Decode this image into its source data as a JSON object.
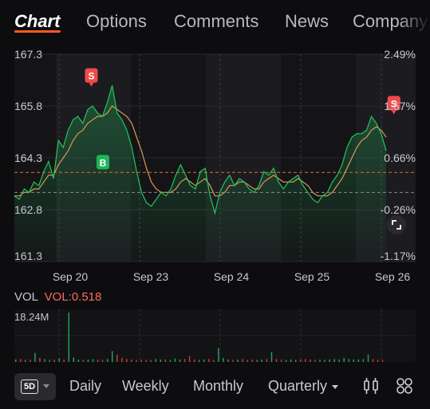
{
  "tabs": [
    {
      "label": "Chart",
      "active": true
    },
    {
      "label": "Options",
      "active": false
    },
    {
      "label": "Comments",
      "active": false
    },
    {
      "label": "News",
      "active": false
    },
    {
      "label": "Company",
      "active": false
    }
  ],
  "chart_data": {
    "type": "line",
    "y_ticks": [
      "167.3",
      "165.8",
      "164.3",
      "162.8",
      "161.3"
    ],
    "pct_ticks": [
      "2.49%",
      "1.57%",
      "0.66%",
      "-0.26%",
      "-1.17%"
    ],
    "x_ticks": [
      "Sep 20",
      "Sep 23",
      "Sep 24",
      "Sep 25",
      "Sep 26"
    ],
    "ylim": [
      161.3,
      167.3
    ],
    "prev_close": 163.3,
    "ref_price": 163.88,
    "markers": [
      {
        "label": "S",
        "type": "sell",
        "day": 1.0,
        "price": 166.2
      },
      {
        "label": "B",
        "type": "buy",
        "day": 1.15,
        "price": 164.2
      },
      {
        "label": "S",
        "type": "sell",
        "day": 4.93,
        "price": 165.4
      }
    ],
    "series": [
      {
        "values": [
          163.2,
          163.1,
          163.4,
          163.3,
          163.6,
          163.5,
          163.9,
          164.2,
          163.7,
          164.8,
          164.6,
          165.1,
          165.4,
          165.5,
          165.3,
          165.7,
          165.8,
          165.6,
          165.5,
          165.9,
          166.4,
          165.6,
          165.4,
          165.1,
          164.6,
          163.9,
          163.3,
          163.0,
          162.9,
          163.1,
          163.3,
          163.2,
          163.4,
          163.8,
          164.1,
          163.8,
          163.5,
          163.4,
          163.9,
          164.0,
          163.2,
          162.7,
          163.3,
          163.6,
          163.8,
          163.5,
          163.7,
          163.6,
          163.4,
          163.3,
          163.5,
          163.9,
          163.8,
          164.0,
          163.6,
          163.4,
          163.6,
          163.7,
          163.8,
          163.5,
          163.3,
          163.1,
          163.0,
          163.2,
          163.3,
          163.6,
          163.8,
          164.1,
          164.6,
          164.9,
          165.0,
          165.0,
          165.1,
          165.5,
          165.3,
          165.0,
          164.5
        ]
      },
      {
        "values": [
          163.2,
          163.2,
          163.3,
          163.3,
          163.4,
          163.4,
          163.6,
          163.8,
          163.8,
          164.1,
          164.3,
          164.5,
          164.8,
          165.0,
          165.1,
          165.3,
          165.4,
          165.5,
          165.5,
          165.6,
          165.8,
          165.7,
          165.6,
          165.5,
          165.3,
          164.9,
          164.5,
          164.0,
          163.6,
          163.4,
          163.3,
          163.3,
          163.3,
          163.4,
          163.6,
          163.7,
          163.6,
          163.5,
          163.6,
          163.7,
          163.5,
          163.2,
          163.2,
          163.3,
          163.5,
          163.5,
          163.6,
          163.6,
          163.5,
          163.4,
          163.4,
          163.6,
          163.7,
          163.8,
          163.7,
          163.6,
          163.6,
          163.6,
          163.7,
          163.6,
          163.5,
          163.3,
          163.2,
          163.2,
          163.2,
          163.3,
          163.5,
          163.7,
          164.0,
          164.3,
          164.6,
          164.8,
          164.9,
          165.1,
          165.2,
          165.1,
          164.9
        ]
      }
    ]
  },
  "volume": {
    "label": "VOL",
    "ind_label": "VOL:0.518",
    "max_label": "18.24M",
    "bars": [
      0.05,
      0.06,
      0.04,
      0.05,
      0.18,
      0.08,
      0.06,
      0.04,
      0.05,
      0.07,
      0.05,
      1.0,
      0.09,
      0.05,
      0.04,
      0.05,
      0.06,
      0.05,
      0.04,
      0.06,
      0.22,
      0.15,
      0.08,
      0.06,
      0.05,
      0.04,
      0.05,
      0.04,
      0.04,
      0.06,
      0.05,
      0.05,
      0.04,
      0.07,
      0.05,
      0.06,
      0.12,
      0.05,
      0.04,
      0.05,
      0.06,
      0.04,
      0.28,
      0.08,
      0.05,
      0.04,
      0.05,
      0.06,
      0.04,
      0.05,
      0.04,
      0.05,
      0.06,
      0.2,
      0.06,
      0.05,
      0.04,
      0.05,
      0.04,
      0.05,
      0.06,
      0.05,
      0.04,
      0.05,
      0.04,
      0.05,
      0.06,
      0.05,
      0.08,
      0.06,
      0.05,
      0.05,
      0.06,
      0.15,
      0.06,
      0.05,
      0.04
    ]
  },
  "periods": {
    "p5d": "5D",
    "daily": "Daily",
    "weekly": "Weekly",
    "monthly": "Monthly",
    "quarterly": "Quarterly"
  },
  "colors": {
    "up": "#22c55e",
    "down": "#ef4444",
    "sell": "#f04a4a",
    "buy": "#22b45a",
    "ma": "#d99a55",
    "accent": "#ff5a24"
  }
}
